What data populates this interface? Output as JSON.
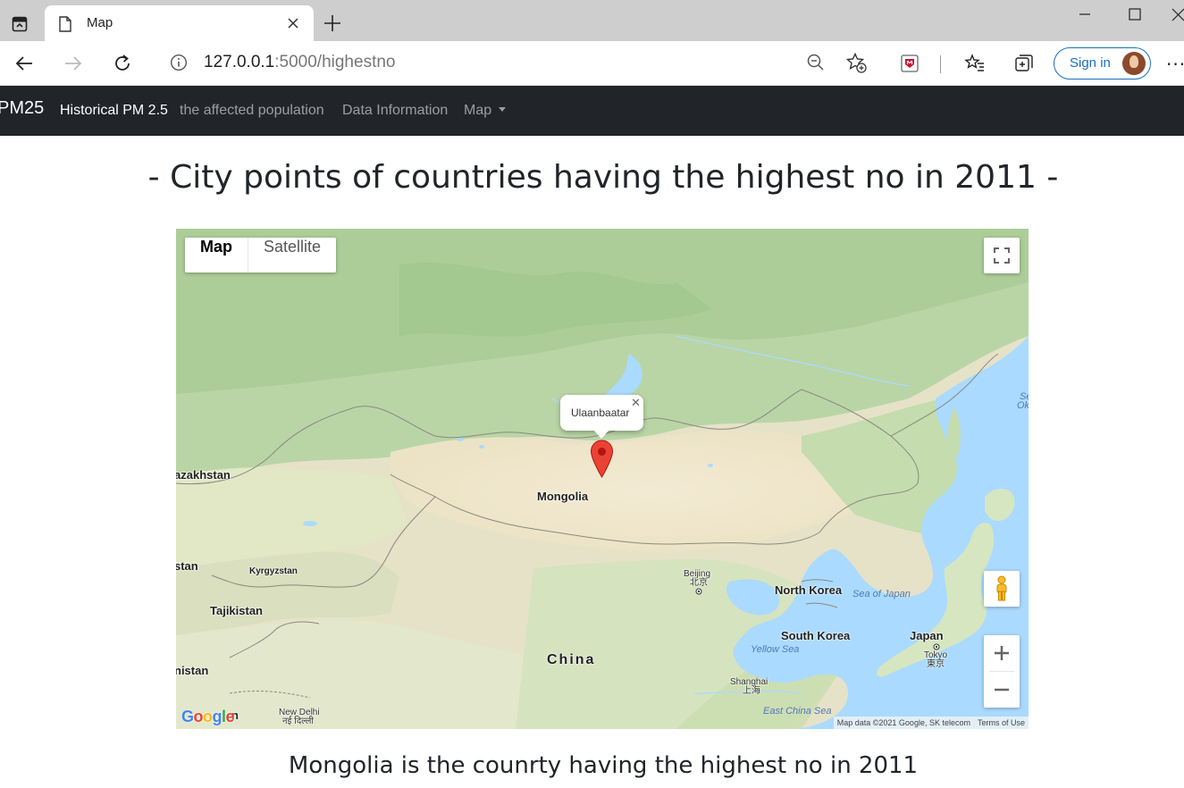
{
  "browser": {
    "tab_title": "Map",
    "address_host": "127.0.0.1",
    "address_path": ":5000/highestno",
    "signin_label": "Sign in"
  },
  "navbar": {
    "brand": "PM25",
    "links": [
      "Historical PM 2.5",
      "the affected population",
      "Data Information",
      "Map"
    ]
  },
  "page": {
    "title": "- City points of countries having the highest no in 2011 -",
    "caption": "Mongolia is the counrty having the highest no in 2011"
  },
  "map": {
    "type_buttons": [
      "Map",
      "Satellite"
    ],
    "infowindow_text": "Ulaanbaatar",
    "labels": {
      "kazakhstan": "azakhstan",
      "mongolia": "Mongolia",
      "stan": "stan",
      "kyrgyzstan": "Kyrgyzstan",
      "tajikistan": "Tajikistan",
      "nistan": "nistan",
      "china": "China",
      "beijing": "Beijing",
      "beijing_local": "北京",
      "north_korea": "North Korea",
      "south_korea": "South Korea",
      "japan": "Japan",
      "tokyo": "Tokyo",
      "tokyo_local": "東京",
      "shanghai": "Shanghai",
      "shanghai_local": "上海",
      "new_delhi": "New Delhi",
      "new_delhi_local": "नई दिल्ली",
      "n_fragment": "n",
      "sea_of_japan": "Sea of Japan",
      "yellow_sea": "Yellow Sea",
      "east_china_sea": "East China Sea",
      "se_fragment": "Se",
      "ok_fragment": "Ok"
    },
    "attribution": "Map data ©2021 Google, SK telecom",
    "terms": "Terms of Use",
    "logo": "Google"
  },
  "colors": {
    "navbar_bg": "#212529",
    "water": "#aadaff",
    "marker": "#ea4335"
  }
}
